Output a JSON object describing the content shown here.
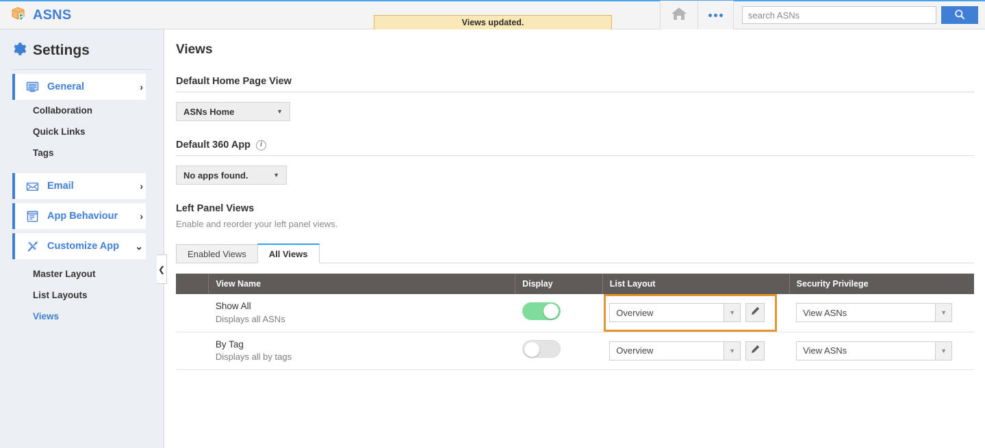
{
  "header": {
    "logo_icon": "package-shield-icon",
    "app_name": "ASNS",
    "flash_message": "Views updated.",
    "home_icon": "home-icon",
    "more_icon": "more-dots-icon",
    "search_placeholder": "search ASNs",
    "search_value": "",
    "search_icon": "search-icon",
    "accent_blue": "#3f7fd6",
    "flash_bg": "#fae8b6",
    "flash_border": "#dcb75e"
  },
  "sidebar": {
    "title": "Settings",
    "gear_icon": "gear-icon",
    "collapse_icon": "chevron-left-icon",
    "groups": [
      {
        "label": "General",
        "icon": "monitor-icon",
        "chevron": "›",
        "expanded": false,
        "children": [
          "Collaboration",
          "Quick Links",
          "Tags"
        ]
      },
      {
        "label": "Email",
        "icon": "envelope-icon",
        "chevron": "›",
        "expanded": false,
        "children": []
      },
      {
        "label": "App Behaviour",
        "icon": "window-doc-icon",
        "chevron": "›",
        "expanded": false,
        "children": []
      },
      {
        "label": "Customize App",
        "icon": "tools-icon",
        "chevron": "⌄",
        "expanded": true,
        "children": [
          "Master Layout",
          "List Layouts",
          "Views"
        ]
      }
    ],
    "active_child": "Views"
  },
  "main": {
    "page_title": "Views",
    "home_section": {
      "heading": "Default Home Page View",
      "select_value": "ASNs Home"
    },
    "app360_section": {
      "heading": "Default 360 App",
      "info_icon": "info-icon",
      "select_value": "No apps found."
    },
    "left_panel_section": {
      "heading": "Left Panel Views",
      "subtitle": "Enable and reorder your left panel views."
    },
    "tabs": [
      {
        "label": "Enabled Views",
        "active": false
      },
      {
        "label": "All Views",
        "active": true
      }
    ],
    "table": {
      "columns": [
        "",
        "View Name",
        "Display",
        "List Layout",
        "Security Privilege"
      ],
      "rows": [
        {
          "name": "Show All",
          "description": "Displays all ASNs",
          "display_on": true,
          "list_layout": "Overview",
          "security_privilege": "View ASNs",
          "highlighted": true,
          "edit_icon": "pencil-icon"
        },
        {
          "name": "By Tag",
          "description": "Displays all by tags",
          "display_on": false,
          "list_layout": "Overview",
          "security_privilege": "View ASNs",
          "highlighted": false,
          "edit_icon": "pencil-icon"
        }
      ]
    },
    "highlight_color": "#e89331",
    "toggle_on_color": "#7fdd9b",
    "toggle_off_color": "#e4e4e4"
  }
}
